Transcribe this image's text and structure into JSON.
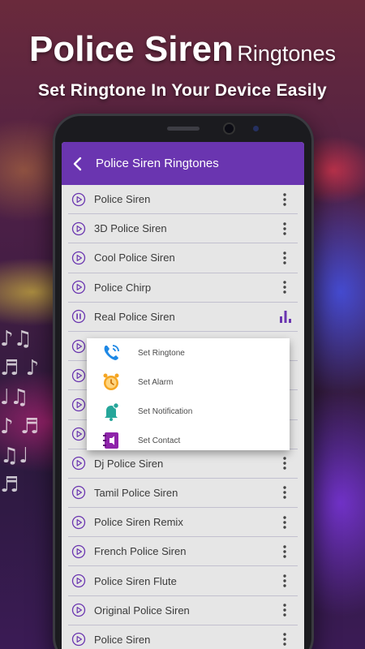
{
  "promo": {
    "title_main": "Police Siren",
    "title_suffix": "Ringtones",
    "subtitle": "Set Ringtone In Your Device Easily"
  },
  "app": {
    "title": "Police Siren Ringtones",
    "accent_color": "#6a35b0",
    "list": [
      {
        "label": "Police Siren",
        "state": "idle"
      },
      {
        "label": "3D Police Siren",
        "state": "idle"
      },
      {
        "label": "Cool Police Siren",
        "state": "idle"
      },
      {
        "label": "Police Chirp",
        "state": "idle"
      },
      {
        "label": "Real Police Siren",
        "state": "playing"
      },
      {
        "label": "",
        "state": "idle"
      },
      {
        "label": "",
        "state": "idle"
      },
      {
        "label": "",
        "state": "idle"
      },
      {
        "label": "",
        "state": "idle"
      },
      {
        "label": "Dj Police Siren",
        "state": "idle"
      },
      {
        "label": "Tamil Police Siren",
        "state": "idle"
      },
      {
        "label": "Police Siren Remix",
        "state": "idle"
      },
      {
        "label": "French Police Siren",
        "state": "idle"
      },
      {
        "label": "Police Siren Flute",
        "state": "idle"
      },
      {
        "label": "Original Police Siren",
        "state": "idle"
      },
      {
        "label": "Police Siren",
        "state": "idle"
      }
    ],
    "popup_menu": [
      {
        "label": "Set Ringtone",
        "icon": "phone-ring-icon"
      },
      {
        "label": "Set Alarm",
        "icon": "alarm-clock-icon"
      },
      {
        "label": "Set Notification",
        "icon": "notification-bell-icon"
      },
      {
        "label": "Set Contact",
        "icon": "contact-book-icon"
      }
    ]
  }
}
